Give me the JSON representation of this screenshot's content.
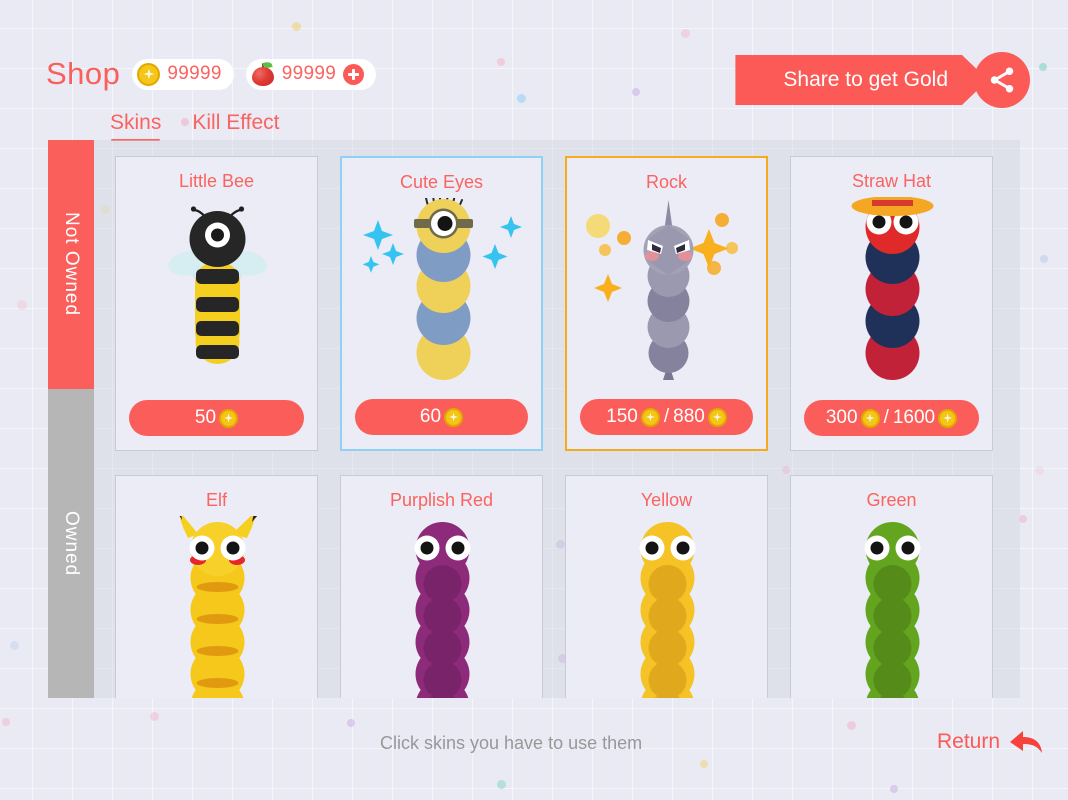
{
  "header": {
    "title": "Shop",
    "gold": {
      "icon": "coin-icon",
      "amount": "99999"
    },
    "apple": {
      "icon": "apple-icon",
      "amount": "99999",
      "add_label": "plus-icon"
    }
  },
  "tabs": [
    {
      "label": "Skins",
      "active": true
    },
    {
      "label": "Kill Effect",
      "active": false
    }
  ],
  "share": {
    "label": "Share to get Gold",
    "icon": "share-icon"
  },
  "side_tabs": [
    {
      "label": "Not Owned",
      "active": true
    },
    {
      "label": "Owned",
      "active": false
    }
  ],
  "skins": [
    {
      "name": "Little Bee",
      "price": "50",
      "price2": "",
      "selected": "none"
    },
    {
      "name": "Cute Eyes",
      "price": "60",
      "price2": "",
      "selected": "blue"
    },
    {
      "name": "Rock",
      "price": "150",
      "price2": "880",
      "selected": "gold"
    },
    {
      "name": "Straw Hat",
      "price": "300",
      "price2": "1600",
      "selected": "none"
    },
    {
      "name": "Elf",
      "price": "",
      "price2": "",
      "selected": "none"
    },
    {
      "name": "Purplish Red",
      "price": "",
      "price2": "",
      "selected": "none"
    },
    {
      "name": "Yellow",
      "price": "",
      "price2": "",
      "selected": "none"
    },
    {
      "name": "Green",
      "price": "",
      "price2": "",
      "selected": "none"
    }
  ],
  "footer": {
    "hint": "Click skins you have to use them",
    "return_label": "Return",
    "return_icon": "back-arrow-icon"
  },
  "colors": {
    "accent_red": "#fb5a57",
    "background": "#e9eaf3",
    "panel": "#cfd1de",
    "gold": "#f5c518",
    "sel_blue": "#8fd0f5",
    "sel_gold": "#f5ab1e",
    "muted_gray": "#b6b6b6"
  }
}
